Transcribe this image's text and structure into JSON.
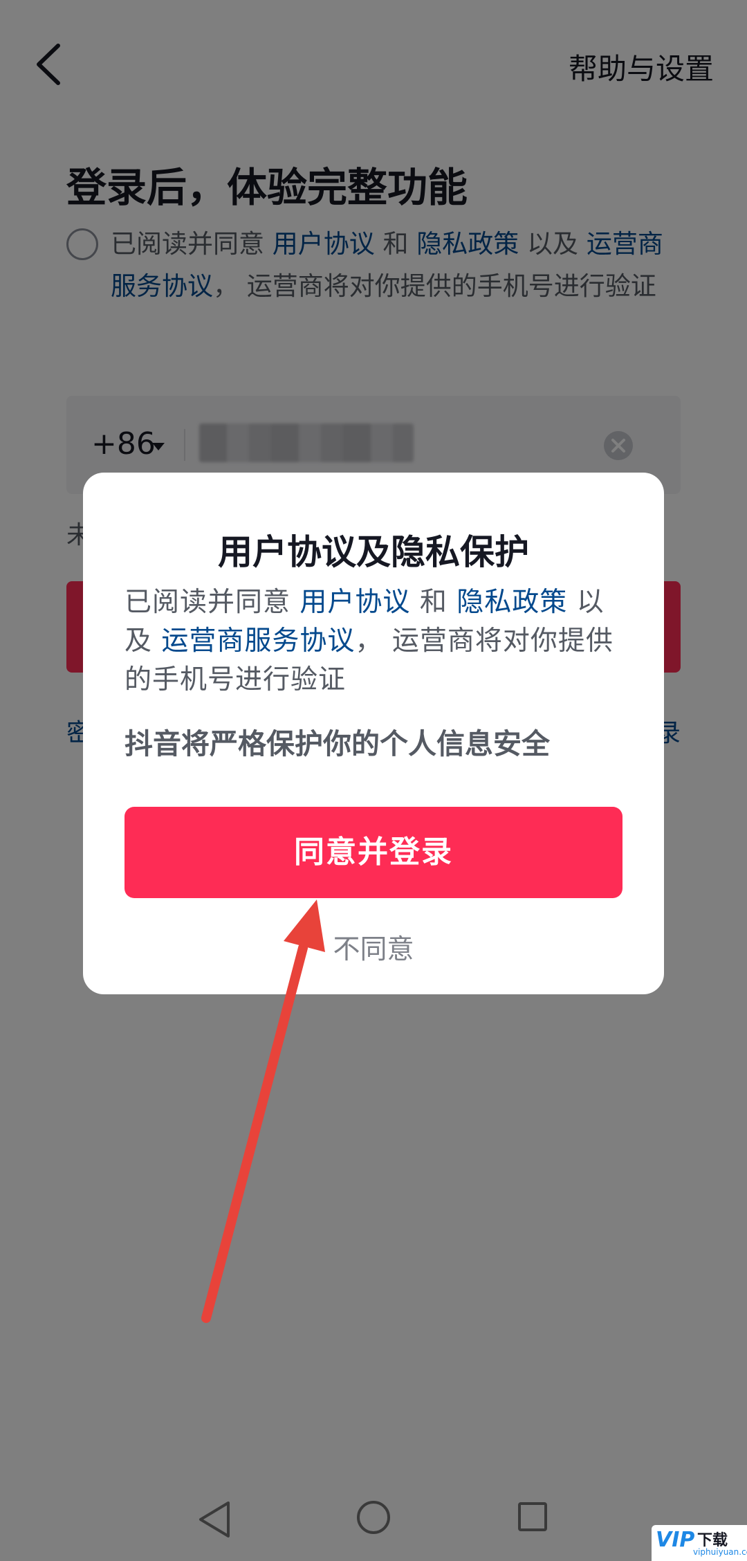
{
  "header": {
    "back_icon": "chevron-left-icon",
    "help_label": "帮助与设置"
  },
  "login": {
    "title": "登录后，体验完整功能",
    "agreement": {
      "prefix": "已阅读并同意 ",
      "user_agreement": "用户协议",
      "and": " 和 ",
      "privacy_policy": "隐私政策",
      "and_also": " 以及 ",
      "carrier_agreement": "运营商服务协议",
      "suffix": "， 运营商将对你提供的手机号进行验证"
    },
    "country_code": "+86",
    "phone_value": "",
    "clear_icon": "clear-circle-icon",
    "hint_partial": "未",
    "password_link_partial": "密",
    "other_link_partial": "录"
  },
  "dialog": {
    "title": "用户协议及隐私保护",
    "body": {
      "prefix": "已阅读并同意 ",
      "user_agreement": "用户协议",
      "and": " 和 ",
      "privacy_policy": "隐私政策",
      "and_also": " 以及 ",
      "carrier_agreement": "运营商服务协议",
      "suffix": "， 运营商将对你提供的手机号进行验证"
    },
    "note": "抖音将严格保护你的个人信息安全",
    "agree_button": "同意并登录",
    "disagree_button": "不同意"
  },
  "navbar": {
    "back_icon": "triangle-back-icon",
    "home_icon": "circle-home-icon",
    "recent_icon": "square-recent-icon"
  },
  "colors": {
    "accent": "#fe2c55",
    "link": "#04498d",
    "annotation_arrow": "#e8433a"
  },
  "watermark": {
    "logo": "VIP",
    "text": "下载",
    "url": "viphuiyuan.cc"
  }
}
